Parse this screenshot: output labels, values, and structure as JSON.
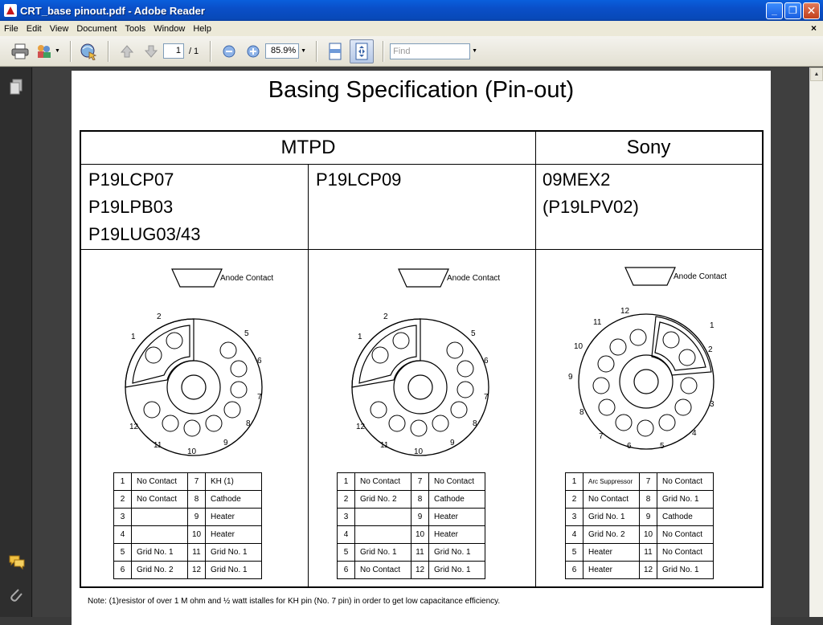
{
  "window": {
    "title": "CRT_base pinout.pdf - Adobe Reader",
    "minimize": "_",
    "maximize": "❐",
    "close": "✕"
  },
  "menu": {
    "items": [
      "File",
      "Edit",
      "View",
      "Document",
      "Tools",
      "Window",
      "Help"
    ],
    "doc_close": "×"
  },
  "toolbar": {
    "page_current": "1",
    "page_total": "/ 1",
    "zoom": "85.9%",
    "find_placeholder": "Find",
    "icons": [
      "print-icon",
      "collaborate-icon",
      "email-icon",
      "prev-page-icon",
      "next-page-icon",
      "zoom-out-icon",
      "zoom-in-icon",
      "fit-page-icon",
      "fit-width-icon"
    ]
  },
  "document": {
    "title": "Basing Specification (Pin-out)",
    "groups": {
      "mtpd": "MTPD",
      "sony": "Sony"
    },
    "columns": [
      {
        "models": [
          "P19LCP07",
          "P19LPB03",
          "P19LUG03/43"
        ],
        "anode_label": "Anode Contact",
        "pin_labels": [
          "1",
          "2",
          "5",
          "6",
          "7",
          "8",
          "9",
          "10",
          "11",
          "12"
        ],
        "pins": [
          [
            "1",
            "No Contact",
            "7",
            "KH (1)"
          ],
          [
            "2",
            "No Contact",
            "8",
            "Cathode"
          ],
          [
            "3",
            "",
            "9",
            "Heater"
          ],
          [
            "4",
            "",
            "10",
            "Heater"
          ],
          [
            "5",
            "Grid No. 1",
            "11",
            "Grid No. 1"
          ],
          [
            "6",
            "Grid No. 2",
            "12",
            "Grid No. 1"
          ]
        ]
      },
      {
        "models": [
          "P19LCP09"
        ],
        "anode_label": "Anode Contact",
        "pin_labels": [
          "1",
          "2",
          "5",
          "6",
          "7",
          "8",
          "9",
          "10",
          "11",
          "12"
        ],
        "pins": [
          [
            "1",
            "No Contact",
            "7",
            "No Contact"
          ],
          [
            "2",
            "Grid No. 2",
            "8",
            "Cathode"
          ],
          [
            "3",
            "",
            "9",
            "Heater"
          ],
          [
            "4",
            "",
            "10",
            "Heater"
          ],
          [
            "5",
            "Grid No. 1",
            "11",
            "Grid No. 1"
          ],
          [
            "6",
            "No Contact",
            "12",
            "Grid No. 1"
          ]
        ]
      },
      {
        "models": [
          "09MEX2",
          "(P19LPV02)"
        ],
        "anode_label": "Anode Contact",
        "pin_labels": [
          "12",
          "11",
          "1",
          "10",
          "2",
          "9",
          "3",
          "8",
          "4",
          "7",
          "6",
          "5"
        ],
        "pins": [
          [
            "1",
            "Arc Suppressor",
            "7",
            "No Contact"
          ],
          [
            "2",
            "No Contact",
            "8",
            "Grid No. 1"
          ],
          [
            "3",
            "Grid No. 1",
            "9",
            "Cathode"
          ],
          [
            "4",
            "Grid No. 2",
            "10",
            "No Contact"
          ],
          [
            "5",
            "Heater",
            "11",
            "No Contact"
          ],
          [
            "6",
            "Heater",
            "12",
            "Grid No. 1"
          ]
        ]
      }
    ],
    "note": "Note: (1)resistor of over 1 M ohm and ½ watt istalles for KH pin (No. 7 pin) in order to get low capacitance efficiency."
  }
}
